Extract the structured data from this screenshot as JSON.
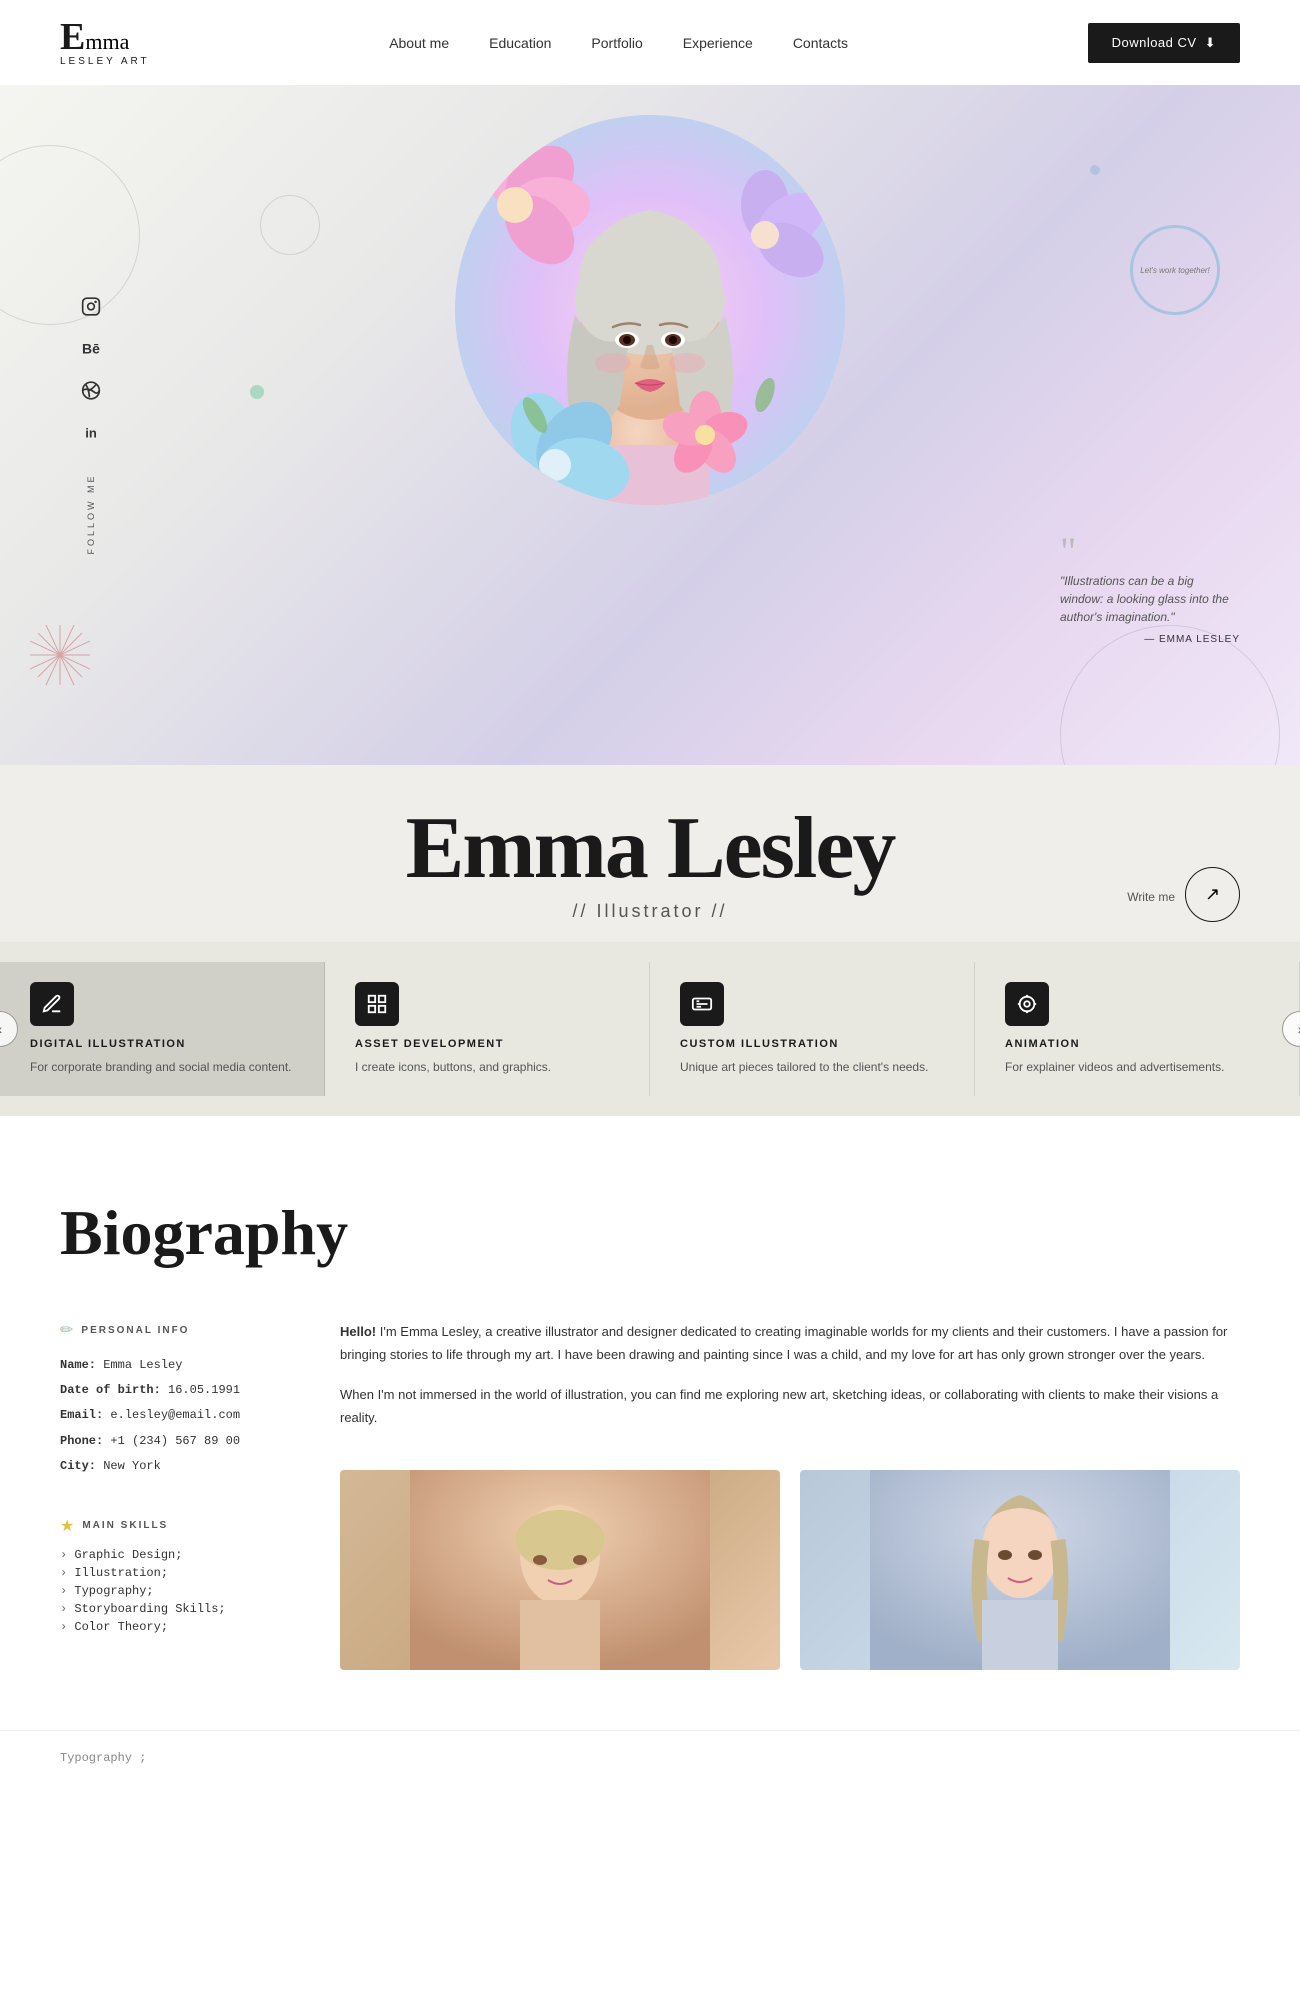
{
  "nav": {
    "logo_letter": "E",
    "logo_name": "mma",
    "logo_sub": "LESLEY ART",
    "links": [
      {
        "label": "About me",
        "href": "#"
      },
      {
        "label": "Education",
        "href": "#"
      },
      {
        "label": "Portfolio",
        "href": "#"
      },
      {
        "label": "Experience",
        "href": "#"
      },
      {
        "label": "Contacts",
        "href": "#"
      }
    ],
    "download_btn": "Download CV"
  },
  "hero": {
    "quote_text": "\"Illustrations can be a big window: a looking glass into the author's imagination.\"",
    "quote_author": "— EMMA LESLEY",
    "lets_work": "Let's work together!",
    "follow_label": "FOLLOW ME"
  },
  "name_section": {
    "name": "Emma Lesley",
    "title": "// Illustrator //",
    "write_me": "Write me"
  },
  "services": {
    "prev_label": "‹",
    "next_label": "›",
    "items": [
      {
        "icon": "✏",
        "title": "DIGITAL ILLUSTRATION",
        "desc": "For corporate branding and social media content.",
        "active": true
      },
      {
        "icon": "⊞",
        "title": "ASSET DEVELOPMENT",
        "desc": "I create icons, buttons, and graphics.",
        "active": false
      },
      {
        "icon": "⌨",
        "title": "CUSTOM ILLUSTRATION",
        "desc": "Unique art pieces tailored to the client's needs.",
        "active": false
      },
      {
        "icon": "◎",
        "title": "ANIMATION",
        "desc": "For explainer videos and advertisements.",
        "active": false
      }
    ]
  },
  "biography": {
    "heading": "Biography",
    "personal_info_label": "PERSONAL INFO",
    "fields": [
      {
        "label": "Name:",
        "value": "Emma Lesley"
      },
      {
        "label": "Date of birth:",
        "value": "16.05.1991"
      },
      {
        "label": "Email:",
        "value": "e.lesley@email.com"
      },
      {
        "label": "Phone:",
        "value": "+1 (234) 567 89 00"
      },
      {
        "label": "City:",
        "value": "New York"
      }
    ],
    "bio_p1_bold": "Hello!",
    "bio_p1": " I'm Emma Lesley, a creative illustrator and designer dedicated to creating imaginable worlds for my clients and their customers. I have a passion for bringing stories to life through my art. I have been drawing and painting since I was a child, and my love for art has only grown stronger over the years.",
    "bio_p2": "When I'm not immersed in the world of illustration, you can find me exploring new art, sketching ideas, or collaborating with clients to make their visions a reality.",
    "main_skills_label": "MAIN SKILLS",
    "skills": [
      "Graphic Design;",
      "Illustration;",
      "Typography;",
      "Storyboarding Skills;",
      "Color Theory;"
    ]
  },
  "footer": {
    "typography_note": "Typography ;"
  },
  "social": [
    {
      "name": "instagram",
      "symbol": "◎"
    },
    {
      "name": "behance",
      "symbol": "Bē"
    },
    {
      "name": "dribbble",
      "symbol": "⊕"
    },
    {
      "name": "linkedin",
      "symbol": "in"
    }
  ]
}
